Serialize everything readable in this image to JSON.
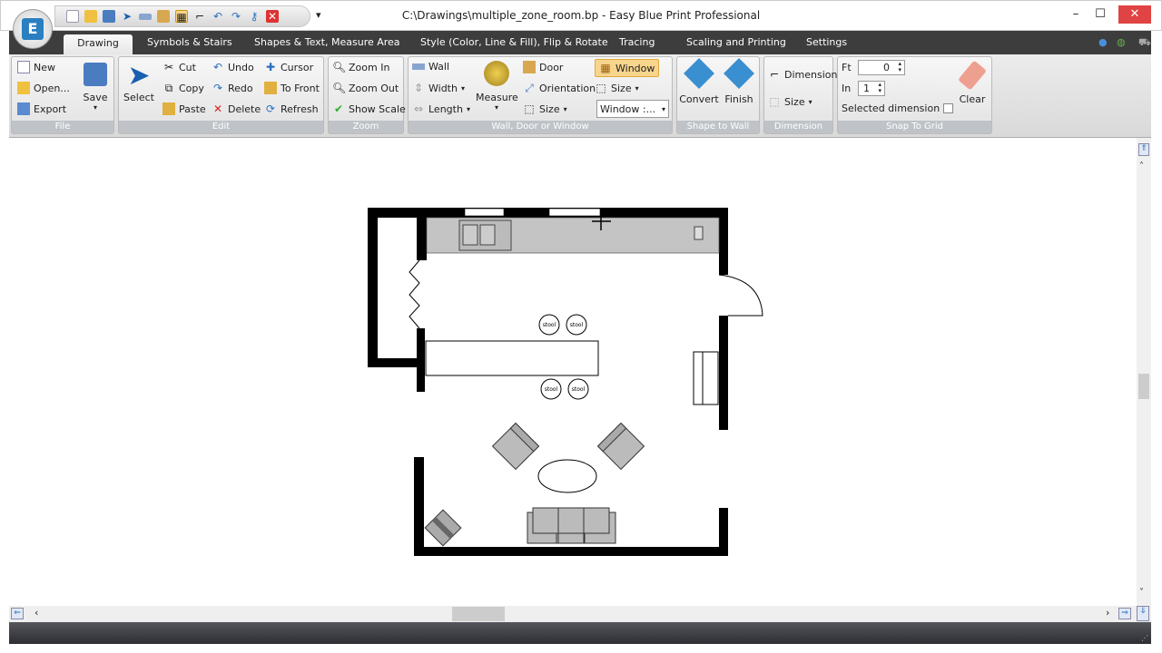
{
  "window": {
    "title": "C:\\Drawings\\multiple_zone_room.bp - Easy Blue Print Professional",
    "logo_letter": "E"
  },
  "tabs": [
    "Drawing",
    "Symbols & Stairs",
    "Shapes & Text, Measure Area",
    "Style (Color, Line & Fill), Flip & Rotate",
    "Tracing",
    "Scaling and Printing",
    "Settings"
  ],
  "ribbon": {
    "file": {
      "label": "File",
      "new": "New",
      "open": "Open...",
      "export": "Export",
      "save": "Save"
    },
    "edit": {
      "label": "Edit",
      "select": "Select",
      "cut": "Cut",
      "copy": "Copy",
      "paste": "Paste",
      "undo": "Undo",
      "redo": "Redo",
      "delete": "Delete",
      "cursor": "Cursor",
      "to_front": "To Front",
      "refresh": "Refresh"
    },
    "zoom": {
      "label": "Zoom",
      "zoom_in": "Zoom In",
      "zoom_out": "Zoom Out",
      "show_scale": "Show Scale"
    },
    "wall": {
      "label": "Wall, Door or Window",
      "wall": "Wall",
      "width": "Width",
      "length": "Length",
      "measure": "Measure",
      "door": "Door",
      "orientation": "Orientation",
      "size": "Size",
      "window": "Window",
      "window_select": "Window :..."
    },
    "shape": {
      "label": "Shape to Wall",
      "convert": "Convert",
      "finish": "Finish"
    },
    "dimension": {
      "label": "Dimension",
      "dimension": "Dimension",
      "size": "Size"
    },
    "snap": {
      "label": "Snap To Grid",
      "ft_label": "Ft",
      "ft_value": "0",
      "in_label": "In",
      "in_value": "1",
      "selected_dimension": "Selected dimension",
      "selected_dimension_checked": false,
      "clear": "Clear"
    }
  },
  "floorplan": {
    "stool_label": "stool"
  },
  "colors": {
    "tabbar": "#3d3d3d",
    "active_highlight": "#f8d58c",
    "close_button": "#e04343",
    "counter": "#c4c4c4"
  }
}
